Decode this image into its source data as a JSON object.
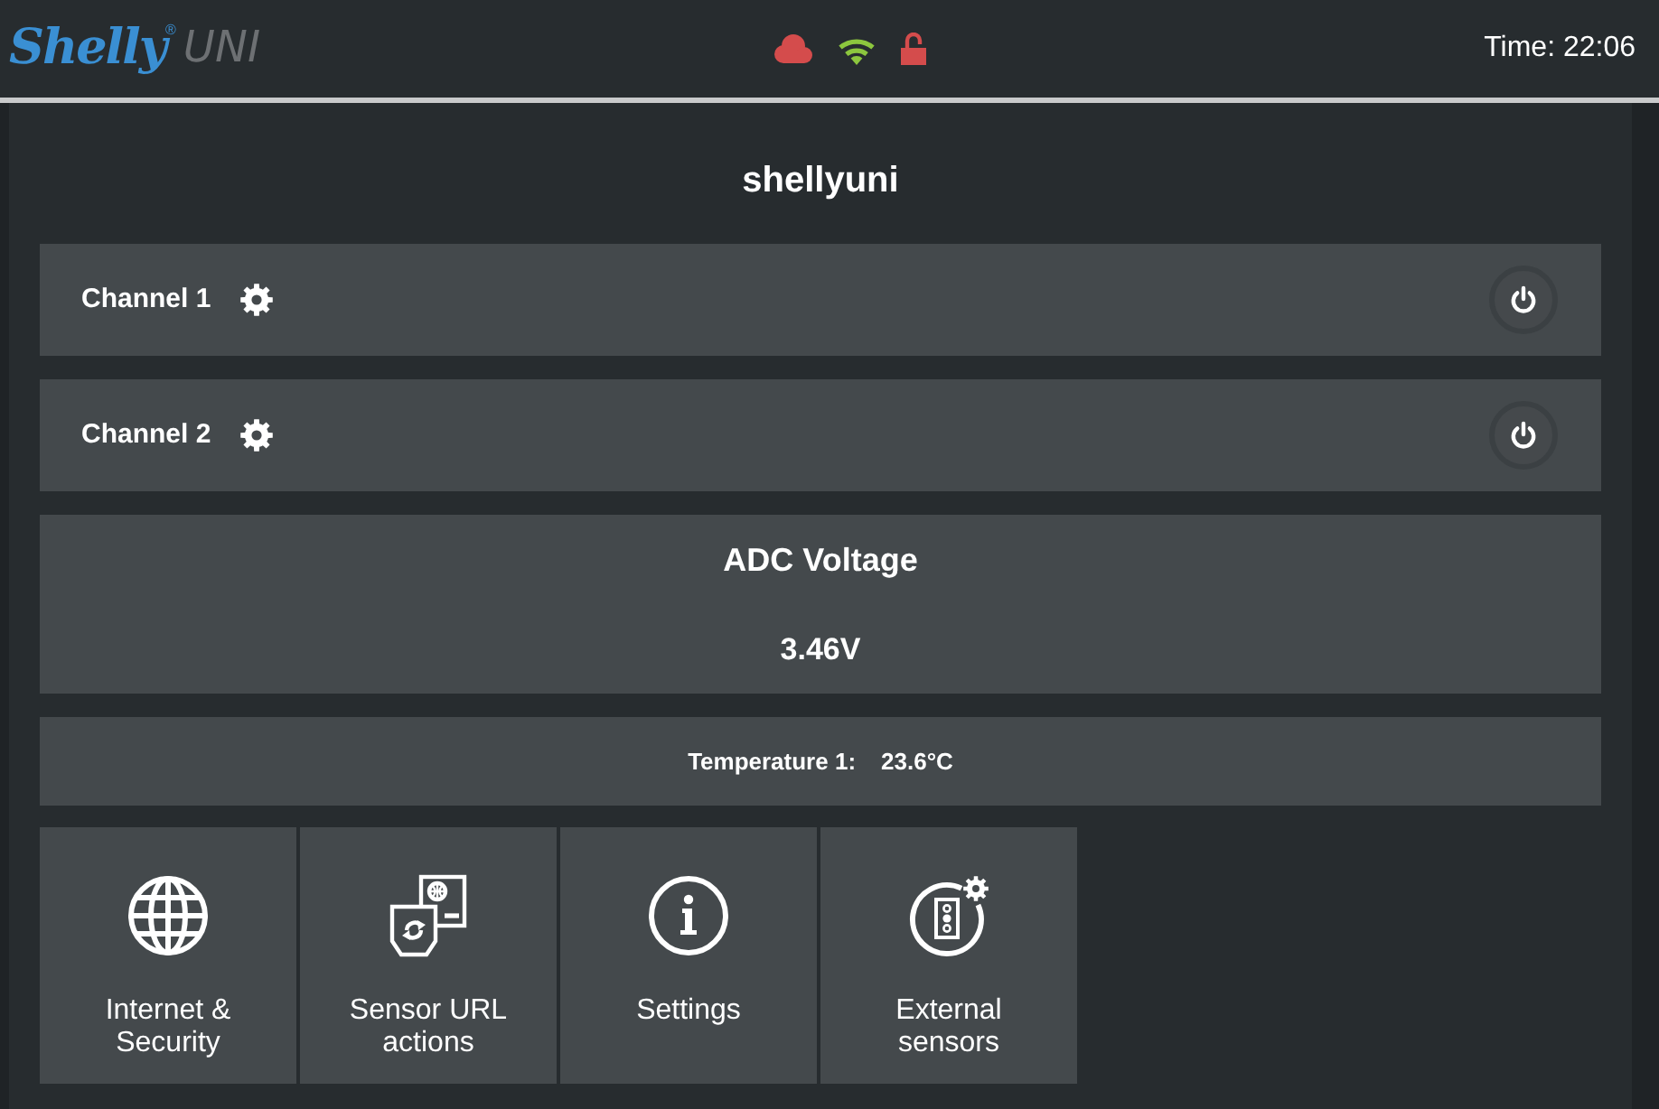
{
  "header": {
    "logo": "Shelly",
    "logo_mark": "®",
    "model": "UNI",
    "cloud_connected": false,
    "wifi_connected": true,
    "login_protected": false,
    "time": "Time: 22:06"
  },
  "device_name": "shellyuni",
  "channels": [
    {
      "name": "Channel 1",
      "on": false
    },
    {
      "name": "Channel 2",
      "on": false
    }
  ],
  "adc": {
    "title": "ADC Voltage",
    "value": "3.46V"
  },
  "temperature": {
    "label": "Temperature 1:",
    "value": "23.6°C"
  },
  "tiles": [
    {
      "label": "Internet & Security",
      "kind": "globe"
    },
    {
      "label": "Sensor URL actions",
      "kind": "sensor-actions"
    },
    {
      "label": "Settings",
      "kind": "info"
    },
    {
      "label": "External sensors",
      "kind": "external-sensors"
    }
  ]
}
